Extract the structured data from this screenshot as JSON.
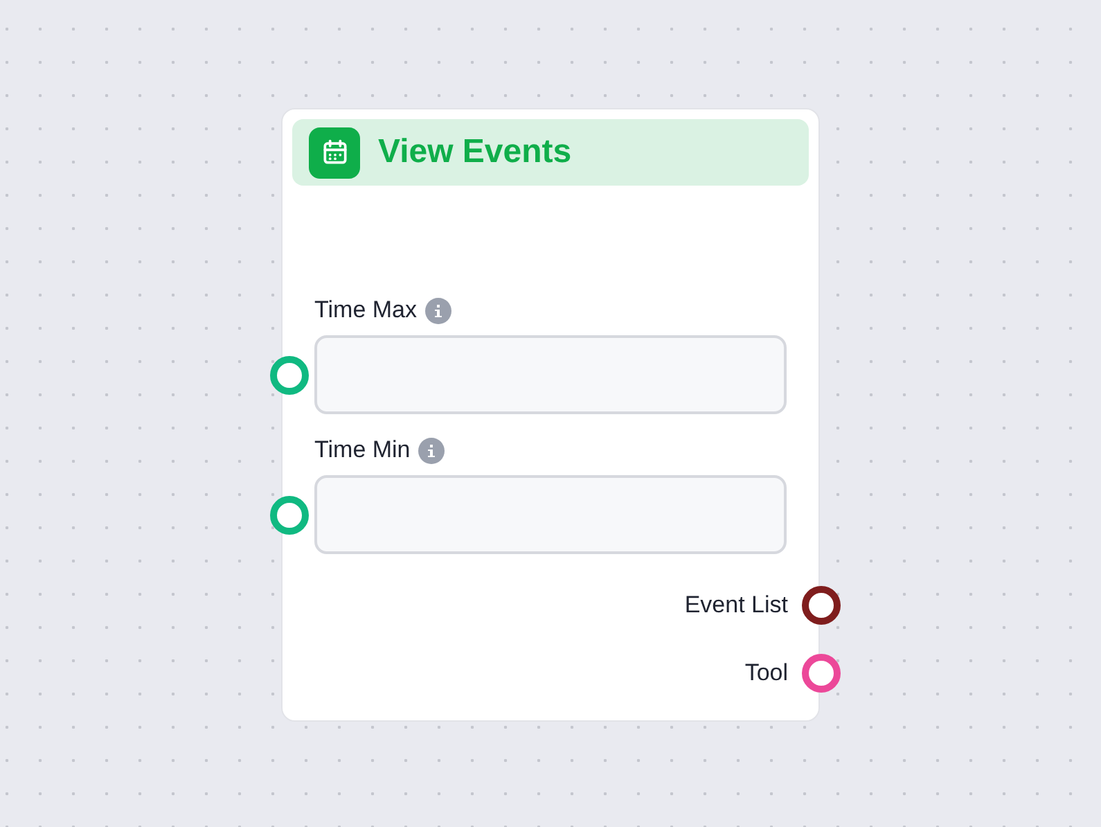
{
  "node": {
    "title": "View Events",
    "inputs": [
      {
        "label": "Time Max",
        "color": "#10b981"
      },
      {
        "label": "Time Min",
        "color": "#10b981"
      }
    ],
    "outputs": [
      {
        "label": "Event List",
        "color": "#7f1d1d"
      },
      {
        "label": "Tool",
        "color": "#ec4899"
      }
    ]
  }
}
